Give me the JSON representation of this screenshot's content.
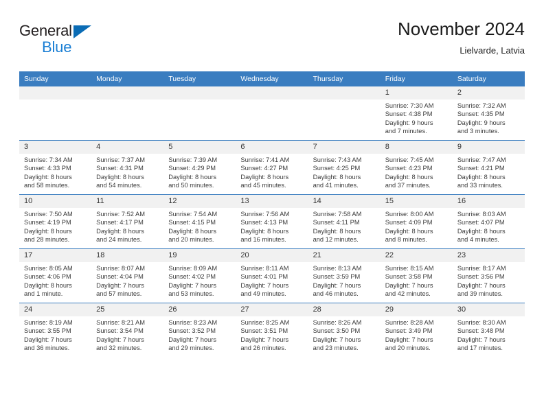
{
  "brand": {
    "name_part1": "General",
    "name_part2": "Blue",
    "logo_icon": "triangle-flag-icon"
  },
  "header": {
    "title": "November 2024",
    "subtitle": "Lielvarde, Latvia"
  },
  "colors": {
    "header_blue": "#3a7dc0",
    "brand_dark": "#231f20",
    "brand_blue": "#1b7fd4",
    "daynum_bg": "#f1f1f1",
    "text": "#3b3b3b"
  },
  "weekday_headers": [
    "Sunday",
    "Monday",
    "Tuesday",
    "Wednesday",
    "Thursday",
    "Friday",
    "Saturday"
  ],
  "labels": {
    "sunrise": "Sunrise:",
    "sunset": "Sunset:",
    "daylight": "Daylight:"
  },
  "weeks": [
    [
      {
        "day": "",
        "lines": []
      },
      {
        "day": "",
        "lines": []
      },
      {
        "day": "",
        "lines": []
      },
      {
        "day": "",
        "lines": []
      },
      {
        "day": "",
        "lines": []
      },
      {
        "day": "1",
        "lines": [
          "Sunrise: 7:30 AM",
          "Sunset: 4:38 PM",
          "Daylight: 9 hours",
          "and 7 minutes."
        ]
      },
      {
        "day": "2",
        "lines": [
          "Sunrise: 7:32 AM",
          "Sunset: 4:35 PM",
          "Daylight: 9 hours",
          "and 3 minutes."
        ]
      }
    ],
    [
      {
        "day": "3",
        "lines": [
          "Sunrise: 7:34 AM",
          "Sunset: 4:33 PM",
          "Daylight: 8 hours",
          "and 58 minutes."
        ]
      },
      {
        "day": "4",
        "lines": [
          "Sunrise: 7:37 AM",
          "Sunset: 4:31 PM",
          "Daylight: 8 hours",
          "and 54 minutes."
        ]
      },
      {
        "day": "5",
        "lines": [
          "Sunrise: 7:39 AM",
          "Sunset: 4:29 PM",
          "Daylight: 8 hours",
          "and 50 minutes."
        ]
      },
      {
        "day": "6",
        "lines": [
          "Sunrise: 7:41 AM",
          "Sunset: 4:27 PM",
          "Daylight: 8 hours",
          "and 45 minutes."
        ]
      },
      {
        "day": "7",
        "lines": [
          "Sunrise: 7:43 AM",
          "Sunset: 4:25 PM",
          "Daylight: 8 hours",
          "and 41 minutes."
        ]
      },
      {
        "day": "8",
        "lines": [
          "Sunrise: 7:45 AM",
          "Sunset: 4:23 PM",
          "Daylight: 8 hours",
          "and 37 minutes."
        ]
      },
      {
        "day": "9",
        "lines": [
          "Sunrise: 7:47 AM",
          "Sunset: 4:21 PM",
          "Daylight: 8 hours",
          "and 33 minutes."
        ]
      }
    ],
    [
      {
        "day": "10",
        "lines": [
          "Sunrise: 7:50 AM",
          "Sunset: 4:19 PM",
          "Daylight: 8 hours",
          "and 28 minutes."
        ]
      },
      {
        "day": "11",
        "lines": [
          "Sunrise: 7:52 AM",
          "Sunset: 4:17 PM",
          "Daylight: 8 hours",
          "and 24 minutes."
        ]
      },
      {
        "day": "12",
        "lines": [
          "Sunrise: 7:54 AM",
          "Sunset: 4:15 PM",
          "Daylight: 8 hours",
          "and 20 minutes."
        ]
      },
      {
        "day": "13",
        "lines": [
          "Sunrise: 7:56 AM",
          "Sunset: 4:13 PM",
          "Daylight: 8 hours",
          "and 16 minutes."
        ]
      },
      {
        "day": "14",
        "lines": [
          "Sunrise: 7:58 AM",
          "Sunset: 4:11 PM",
          "Daylight: 8 hours",
          "and 12 minutes."
        ]
      },
      {
        "day": "15",
        "lines": [
          "Sunrise: 8:00 AM",
          "Sunset: 4:09 PM",
          "Daylight: 8 hours",
          "and 8 minutes."
        ]
      },
      {
        "day": "16",
        "lines": [
          "Sunrise: 8:03 AM",
          "Sunset: 4:07 PM",
          "Daylight: 8 hours",
          "and 4 minutes."
        ]
      }
    ],
    [
      {
        "day": "17",
        "lines": [
          "Sunrise: 8:05 AM",
          "Sunset: 4:06 PM",
          "Daylight: 8 hours",
          "and 1 minute."
        ]
      },
      {
        "day": "18",
        "lines": [
          "Sunrise: 8:07 AM",
          "Sunset: 4:04 PM",
          "Daylight: 7 hours",
          "and 57 minutes."
        ]
      },
      {
        "day": "19",
        "lines": [
          "Sunrise: 8:09 AM",
          "Sunset: 4:02 PM",
          "Daylight: 7 hours",
          "and 53 minutes."
        ]
      },
      {
        "day": "20",
        "lines": [
          "Sunrise: 8:11 AM",
          "Sunset: 4:01 PM",
          "Daylight: 7 hours",
          "and 49 minutes."
        ]
      },
      {
        "day": "21",
        "lines": [
          "Sunrise: 8:13 AM",
          "Sunset: 3:59 PM",
          "Daylight: 7 hours",
          "and 46 minutes."
        ]
      },
      {
        "day": "22",
        "lines": [
          "Sunrise: 8:15 AM",
          "Sunset: 3:58 PM",
          "Daylight: 7 hours",
          "and 42 minutes."
        ]
      },
      {
        "day": "23",
        "lines": [
          "Sunrise: 8:17 AM",
          "Sunset: 3:56 PM",
          "Daylight: 7 hours",
          "and 39 minutes."
        ]
      }
    ],
    [
      {
        "day": "24",
        "lines": [
          "Sunrise: 8:19 AM",
          "Sunset: 3:55 PM",
          "Daylight: 7 hours",
          "and 36 minutes."
        ]
      },
      {
        "day": "25",
        "lines": [
          "Sunrise: 8:21 AM",
          "Sunset: 3:54 PM",
          "Daylight: 7 hours",
          "and 32 minutes."
        ]
      },
      {
        "day": "26",
        "lines": [
          "Sunrise: 8:23 AM",
          "Sunset: 3:52 PM",
          "Daylight: 7 hours",
          "and 29 minutes."
        ]
      },
      {
        "day": "27",
        "lines": [
          "Sunrise: 8:25 AM",
          "Sunset: 3:51 PM",
          "Daylight: 7 hours",
          "and 26 minutes."
        ]
      },
      {
        "day": "28",
        "lines": [
          "Sunrise: 8:26 AM",
          "Sunset: 3:50 PM",
          "Daylight: 7 hours",
          "and 23 minutes."
        ]
      },
      {
        "day": "29",
        "lines": [
          "Sunrise: 8:28 AM",
          "Sunset: 3:49 PM",
          "Daylight: 7 hours",
          "and 20 minutes."
        ]
      },
      {
        "day": "30",
        "lines": [
          "Sunrise: 8:30 AM",
          "Sunset: 3:48 PM",
          "Daylight: 7 hours",
          "and 17 minutes."
        ]
      }
    ]
  ]
}
